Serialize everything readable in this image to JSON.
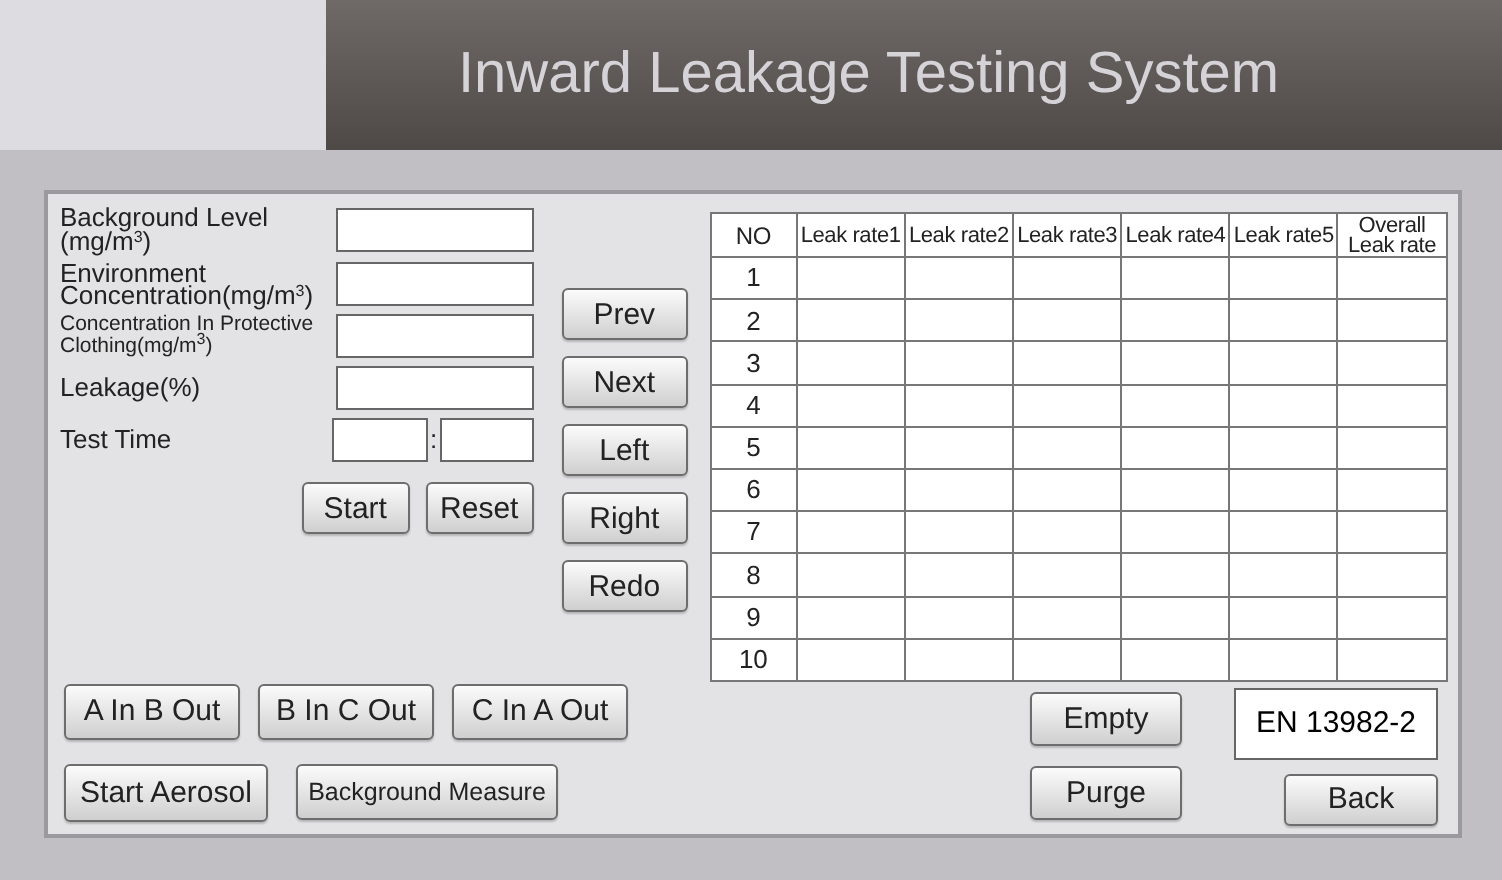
{
  "header": {
    "title": "Inward Leakage Testing System"
  },
  "fields": [
    {
      "label": "Background Level (mg/m$^{3}$)",
      "kind": "normal"
    },
    {
      "label": "Environment Concentration(mg/m$^{3}$)",
      "kind": "tight"
    },
    {
      "label": "Concentration In Protective Clothing(mg/m$^{3}$)",
      "kind": "small"
    },
    {
      "label": "Leakage(%)",
      "kind": "normal"
    }
  ],
  "test_time": {
    "label": "Test Time",
    "separator": ":"
  },
  "form_buttons": [
    "Start",
    "Reset"
  ],
  "nav_buttons": [
    "Prev",
    "Next",
    "Left",
    "Right",
    "Redo"
  ],
  "table": {
    "columns": [
      "NO",
      "Leak rate1",
      "Leak rate2",
      "Leak rate3",
      "Leak rate4",
      "Leak rate5",
      "Overall Leak rate"
    ],
    "rows": [
      {
        "no": "1"
      },
      {
        "no": "2"
      },
      {
        "no": "3"
      },
      {
        "no": "4"
      },
      {
        "no": "5"
      },
      {
        "no": "6"
      },
      {
        "no": "7"
      },
      {
        "no": "8"
      },
      {
        "no": "9"
      },
      {
        "no": "10"
      }
    ]
  },
  "valve_buttons": [
    "A In B Out",
    "B In C Out",
    "C In A Out"
  ],
  "action_buttons": [
    {
      "label": "Start Aerosol",
      "kind": "normal"
    },
    {
      "label": "Background Measure",
      "kind": "small"
    }
  ],
  "right_buttons": [
    "Empty",
    "Purge"
  ],
  "standard": {
    "value": "EN 13982-2"
  },
  "back_button": "Back"
}
